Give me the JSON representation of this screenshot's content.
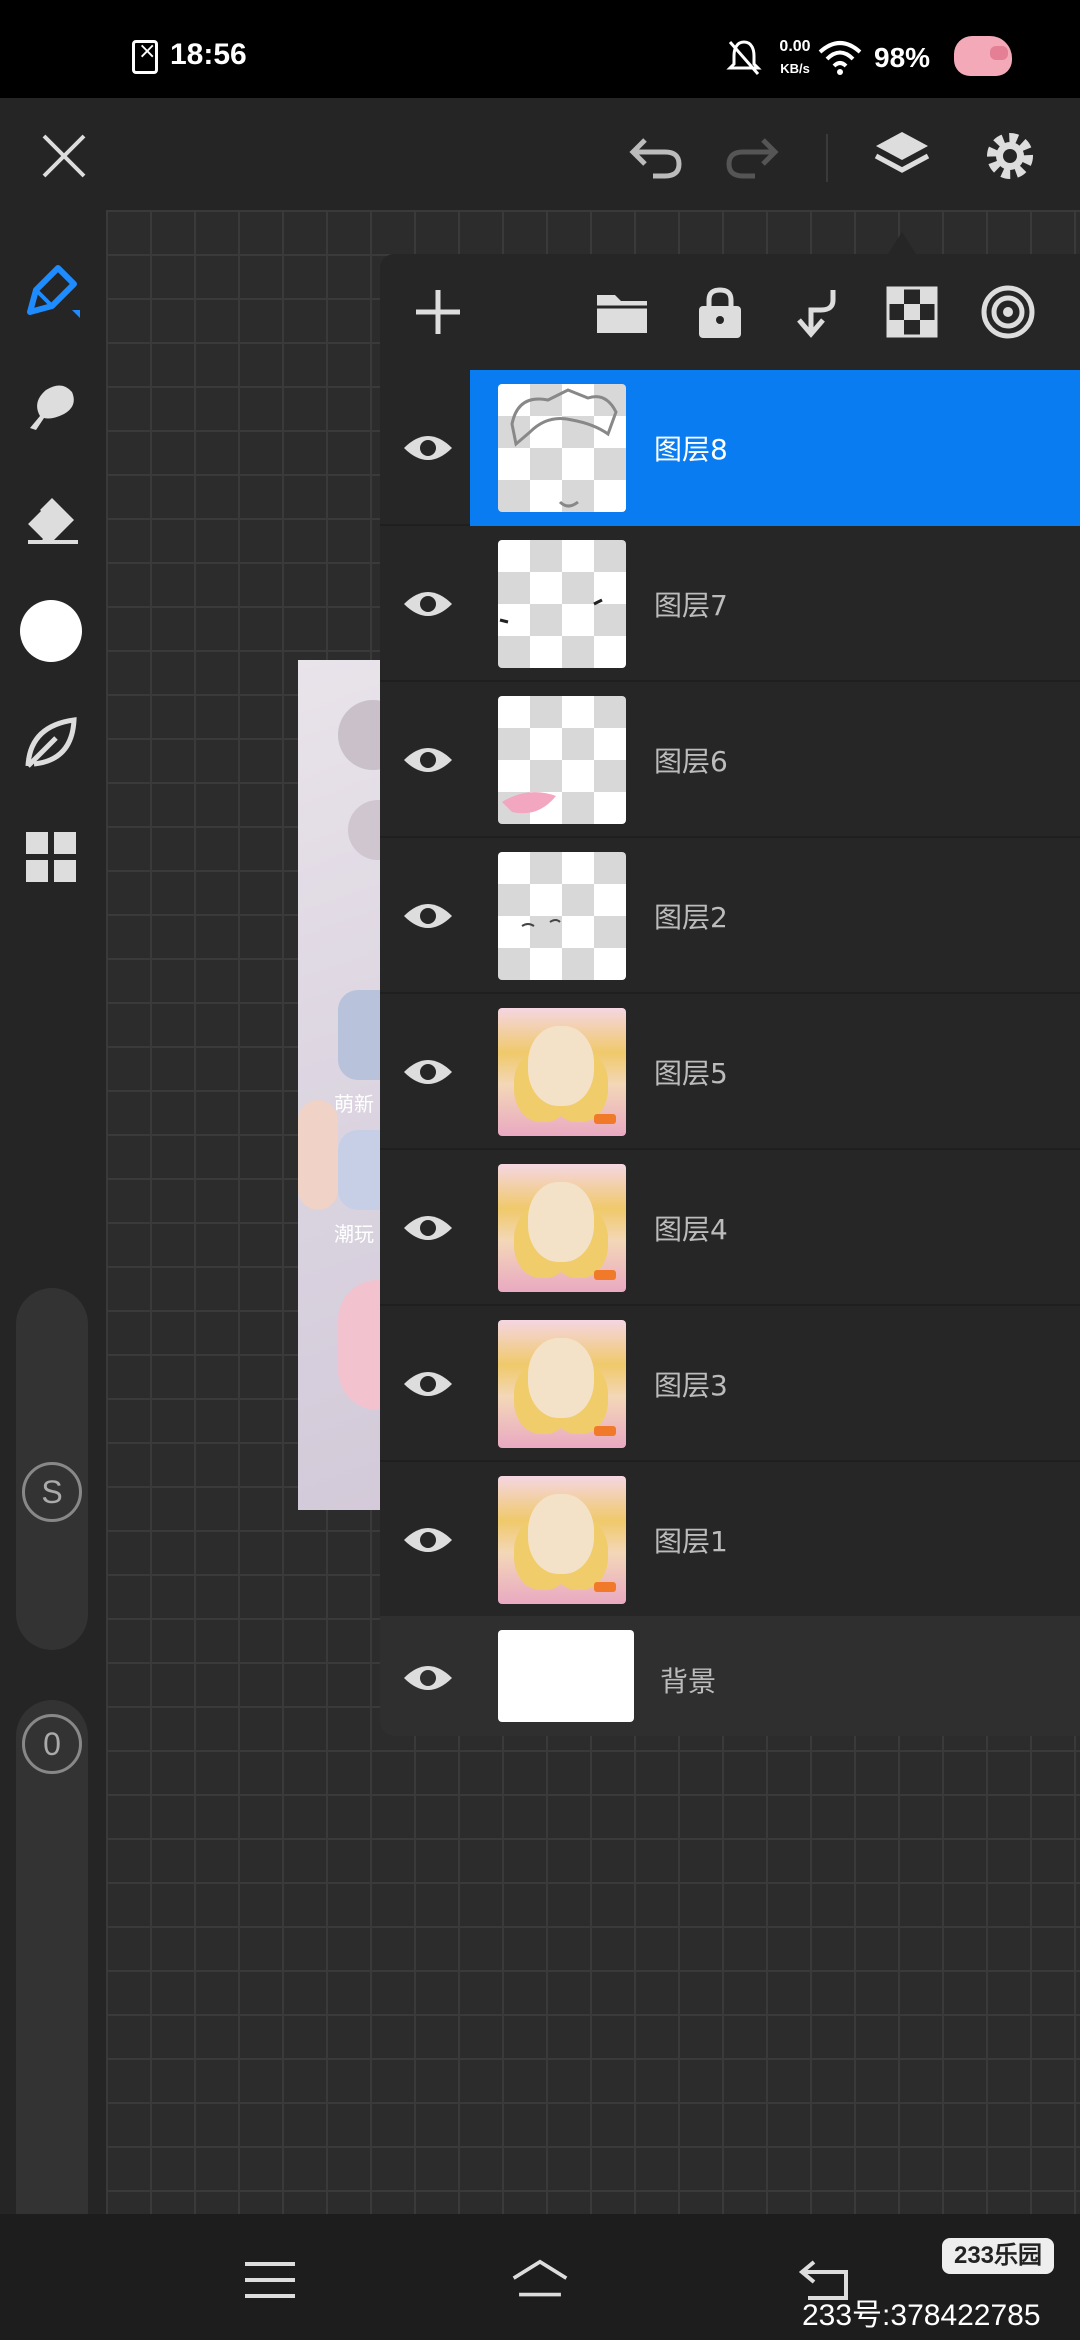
{
  "status_bar": {
    "time": "18:56",
    "net_speed_value": "0.00",
    "net_speed_unit": "KB/s",
    "battery": "98%"
  },
  "toolbar": {
    "icons": [
      "close-icon",
      "undo-icon",
      "redo-icon",
      "layers-icon",
      "settings-icon"
    ]
  },
  "tools": {
    "icons": [
      "pen-icon",
      "smudge-icon",
      "eraser-icon",
      "color-icon",
      "leaf-icon",
      "grid-icon"
    ],
    "size_button": "S",
    "opacity_button": "0"
  },
  "canvas_image": {
    "texts": [
      "萌新",
      "潮玩"
    ]
  },
  "layers_panel": {
    "actions": [
      "add-icon",
      "folder-icon",
      "lock-icon",
      "merge-down-icon",
      "transparency-icon",
      "target-icon"
    ],
    "layers": [
      {
        "name": "图层8",
        "thumb": "sketch",
        "active": true
      },
      {
        "name": "图层7",
        "thumb": "transparent"
      },
      {
        "name": "图层6",
        "thumb": "transparent"
      },
      {
        "name": "图层2",
        "thumb": "transparent"
      },
      {
        "name": "图层5",
        "thumb": "portrait"
      },
      {
        "name": "图层4",
        "thumb": "portrait"
      },
      {
        "name": "图层3",
        "thumb": "portrait"
      },
      {
        "name": "图层1",
        "thumb": "portrait"
      }
    ],
    "background": {
      "name": "背景"
    }
  },
  "nav": {
    "icons": [
      "menu-icon",
      "home-icon",
      "back-icon"
    ]
  },
  "watermark": {
    "logo": "233乐园",
    "id": "233号:378422785"
  },
  "colors": {
    "accent": "#0a7cf2",
    "panel": "#262626",
    "canvas": "#2c2c2c"
  }
}
